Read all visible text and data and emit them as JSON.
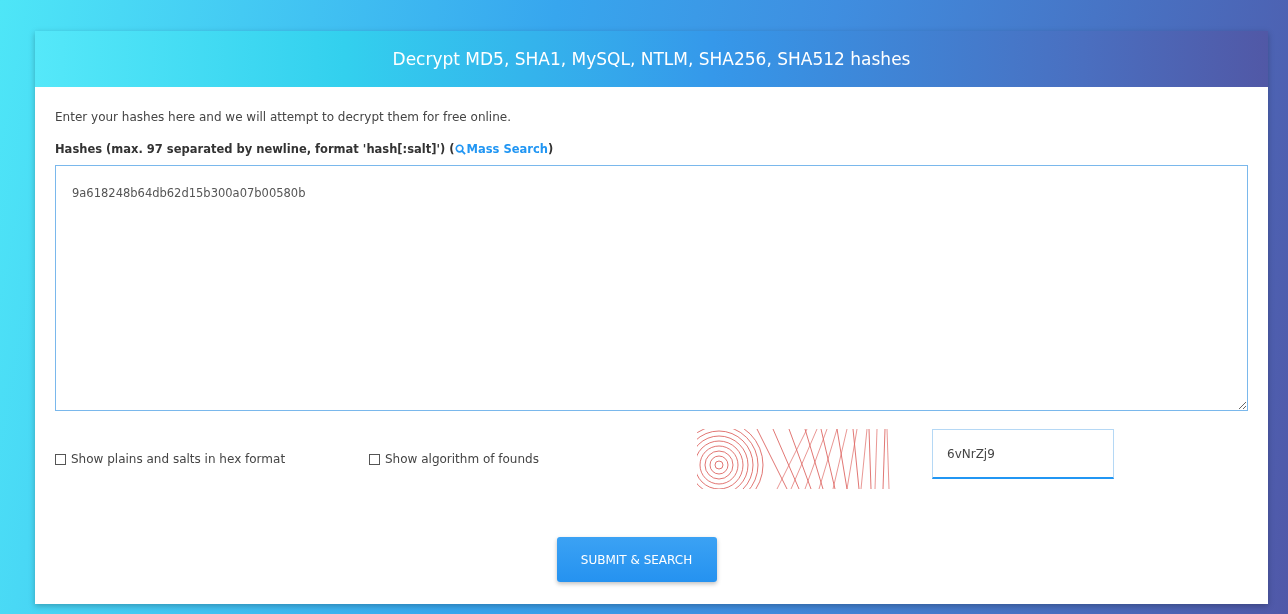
{
  "header": {
    "title": "Decrypt MD5, SHA1, MySQL, NTLM, SHA256, SHA512 hashes"
  },
  "intro": "Enter your hashes here and we will attempt to decrypt them for free online.",
  "hashes_label": {
    "text": "Hashes (max. 97 separated by newline, format 'hash[:salt]') (",
    "link": "Mass Search",
    "close": ")"
  },
  "hashes_field": {
    "value": "9a618248b64db62d15b300a07b00580b"
  },
  "options": [
    {
      "label": "Show plains and salts in hex format",
      "checked": false
    },
    {
      "label": "Show algorithm of founds",
      "checked": false
    }
  ],
  "captcha_field": {
    "value": "6vNrZj9",
    "focused": true
  },
  "submit_button": "SUBMIT & SEARCH"
}
